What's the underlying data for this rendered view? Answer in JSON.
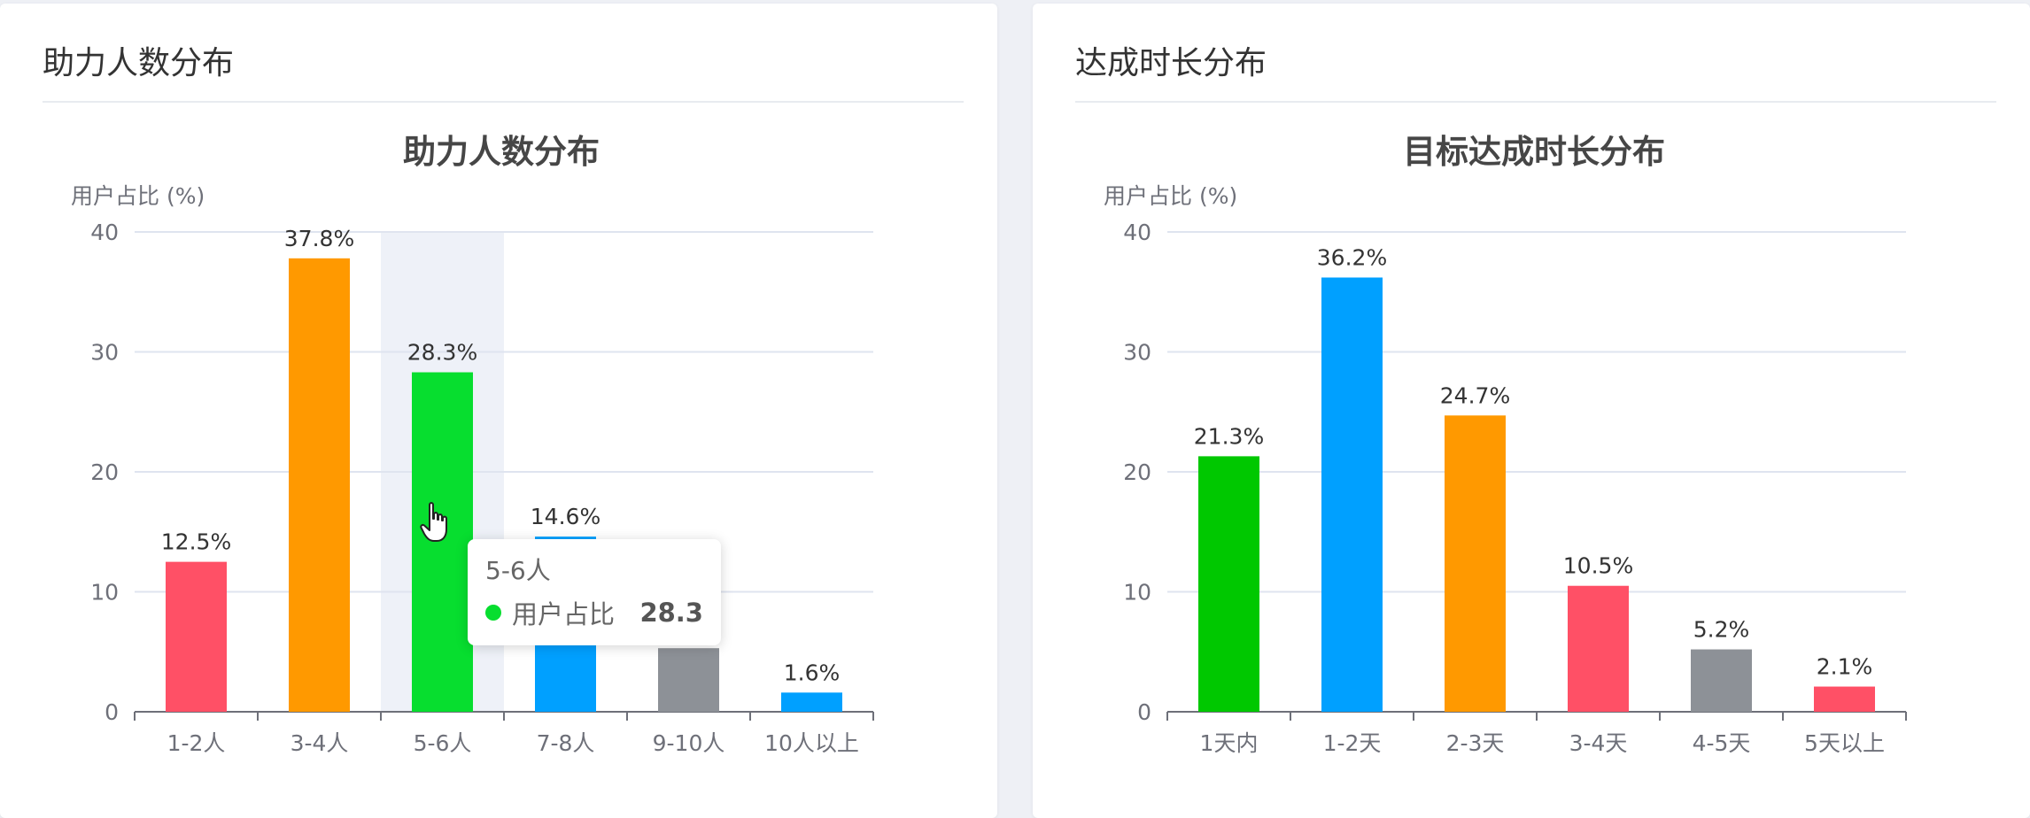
{
  "colors": {
    "red": "#ff5066",
    "orange": "#ff9900",
    "green": "#07de2f",
    "green2": "#00c800",
    "blue": "#00a0ff",
    "gray": "#8d9197",
    "hover_band": "#eef1f8",
    "grid": "#dfe4ef",
    "axis": "#6e7079"
  },
  "left_panel": {
    "title": "助力人数分布"
  },
  "right_panel": {
    "title": "达成时长分布"
  },
  "tooltip": {
    "title": "5-6人",
    "series_name": "用户占比",
    "value": "28.3",
    "color": "#07de2f"
  },
  "cursor": {
    "icon": "hand-pointer-icon"
  },
  "chart_data": [
    {
      "type": "bar",
      "title": "助力人数分布",
      "ylabel": "用户占比 (%)",
      "ylim": [
        0,
        40
      ],
      "yticks": [
        0,
        10,
        20,
        30,
        40
      ],
      "categories": [
        "1-2人",
        "3-4人",
        "5-6人",
        "7-8人",
        "9-10人",
        "10人以上"
      ],
      "values": [
        12.5,
        37.8,
        28.3,
        14.6,
        5.3,
        1.6
      ],
      "labels": [
        "12.5%",
        "37.8%",
        "28.3%",
        "14.6%",
        "",
        "1.6%"
      ],
      "bar_colors": [
        "#ff5066",
        "#ff9900",
        "#07de2f",
        "#00a0ff",
        "#8d9197",
        "#00a0ff"
      ],
      "highlighted_category": "5-6人",
      "grid": true
    },
    {
      "type": "bar",
      "title": "目标达成时长分布",
      "ylabel": "用户占比 (%)",
      "ylim": [
        0,
        40
      ],
      "yticks": [
        0,
        10,
        20,
        30,
        40
      ],
      "categories": [
        "1天内",
        "1-2天",
        "2-3天",
        "3-4天",
        "4-5天",
        "5天以上"
      ],
      "values": [
        21.3,
        36.2,
        24.7,
        10.5,
        5.2,
        2.1
      ],
      "labels": [
        "21.3%",
        "36.2%",
        "24.7%",
        "10.5%",
        "5.2%",
        "2.1%"
      ],
      "bar_colors": [
        "#00c800",
        "#00a0ff",
        "#ff9900",
        "#ff5066",
        "#8d9197",
        "#ff5066"
      ],
      "grid": true
    }
  ]
}
